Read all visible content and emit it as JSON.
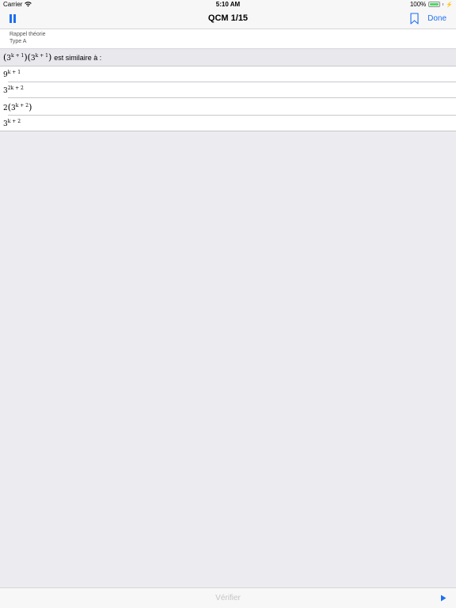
{
  "status_bar": {
    "carrier": "Carrier",
    "time": "5:10 AM",
    "battery": "100%"
  },
  "nav": {
    "title": "QCM 1/15",
    "done_label": "Done",
    "icons": [
      "pause-icon",
      "bookmark-icon"
    ]
  },
  "header": {
    "line1": "Rappel théorie",
    "line2": "Type A"
  },
  "question": {
    "base": "3",
    "exponent": "k + 1",
    "text": "est similaire à :"
  },
  "answers": [
    {
      "coef": "",
      "base": "9",
      "exponent": "k + 1",
      "paren": false
    },
    {
      "coef": "",
      "base": "3",
      "exponent": "2k + 2",
      "paren": false
    },
    {
      "coef": "2",
      "base": "3",
      "exponent": "k + 2",
      "paren": true
    },
    {
      "coef": "",
      "base": "3",
      "exponent": "k + 2",
      "paren": false
    }
  ],
  "bottom": {
    "verify_label": "Vérifier",
    "next_icon": "play-icon"
  },
  "colors": {
    "accent": "#1e6ff1",
    "disabled": "#c4c4c8",
    "background": "#ebebf0",
    "battery": "#4cd964"
  }
}
